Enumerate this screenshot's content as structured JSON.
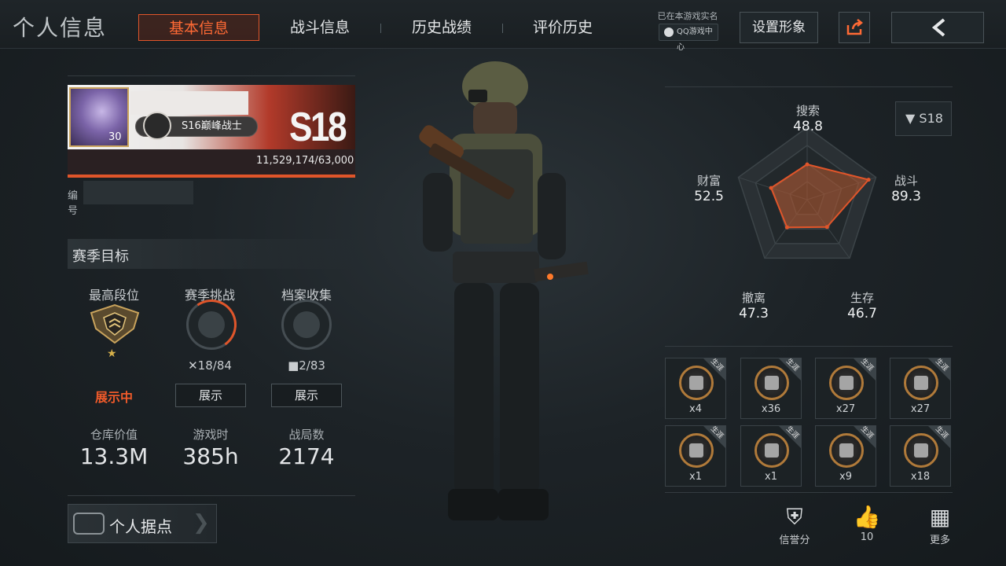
{
  "header": {
    "title": "个人信息",
    "tabs": [
      "基本信息",
      "战斗信息",
      "历史战绩",
      "评价历史"
    ],
    "realname_text": "已在本游戏实名",
    "qq_badge": "QQ游戏中心",
    "set_avatar": "设置形象"
  },
  "profile": {
    "level": "30",
    "rank_title": "S16巅峰战士",
    "season_badge": "S18",
    "progress": "11,529,174/63,000",
    "id_label": "编号"
  },
  "season_goals": {
    "title": "赛季目标",
    "goals": [
      {
        "label": "最高段位",
        "stat": "",
        "action": "展示中"
      },
      {
        "label": "赛季挑战",
        "stat": "18/84",
        "action": "展示"
      },
      {
        "label": "档案收集",
        "stat": "2/83",
        "action": "展示"
      }
    ],
    "challenge_progress": 0.21
  },
  "stats": [
    {
      "label": "仓库价值",
      "value": "13.3M"
    },
    {
      "label": "游戏时",
      "value": "385h"
    },
    {
      "label": "战局数",
      "value": "2174"
    }
  ],
  "base_button": "个人据点",
  "radar": {
    "season": "S18",
    "axes": [
      {
        "name": "搜索",
        "value": "48.8"
      },
      {
        "name": "战斗",
        "value": "89.3"
      },
      {
        "name": "生存",
        "value": "46.7"
      },
      {
        "name": "撤离",
        "value": "47.3"
      },
      {
        "name": "财富",
        "value": "52.5"
      }
    ]
  },
  "achievements": {
    "tag": "生涯",
    "counts": [
      "x4",
      "x36",
      "x27",
      "x27",
      "x1",
      "x1",
      "x9",
      "x18"
    ]
  },
  "bottom_actions": [
    {
      "label": "信誉分",
      "icon": "shield-star-icon"
    },
    {
      "label": "10",
      "icon": "thumbs-up-icon"
    },
    {
      "label": "更多",
      "icon": "grid-icon"
    }
  ],
  "colors": {
    "accent": "#e0552a",
    "radar_fill": "#b85a30"
  }
}
